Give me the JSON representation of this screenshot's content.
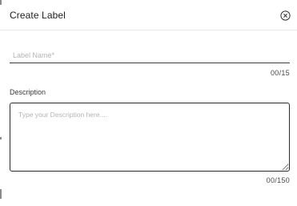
{
  "dialog": {
    "title": "Create Label",
    "close_icon": "close-circle-icon"
  },
  "label_name": {
    "placeholder": "Label Name*",
    "value": "",
    "counter": "00/15"
  },
  "description": {
    "label": "Description",
    "placeholder": "Type your Description here....",
    "value": "",
    "counter": "00/150"
  },
  "colors": {
    "text": "#222222",
    "placeholder": "#b5b5b5",
    "border": "#2a2a2a",
    "divider": "#e8e8e8"
  }
}
